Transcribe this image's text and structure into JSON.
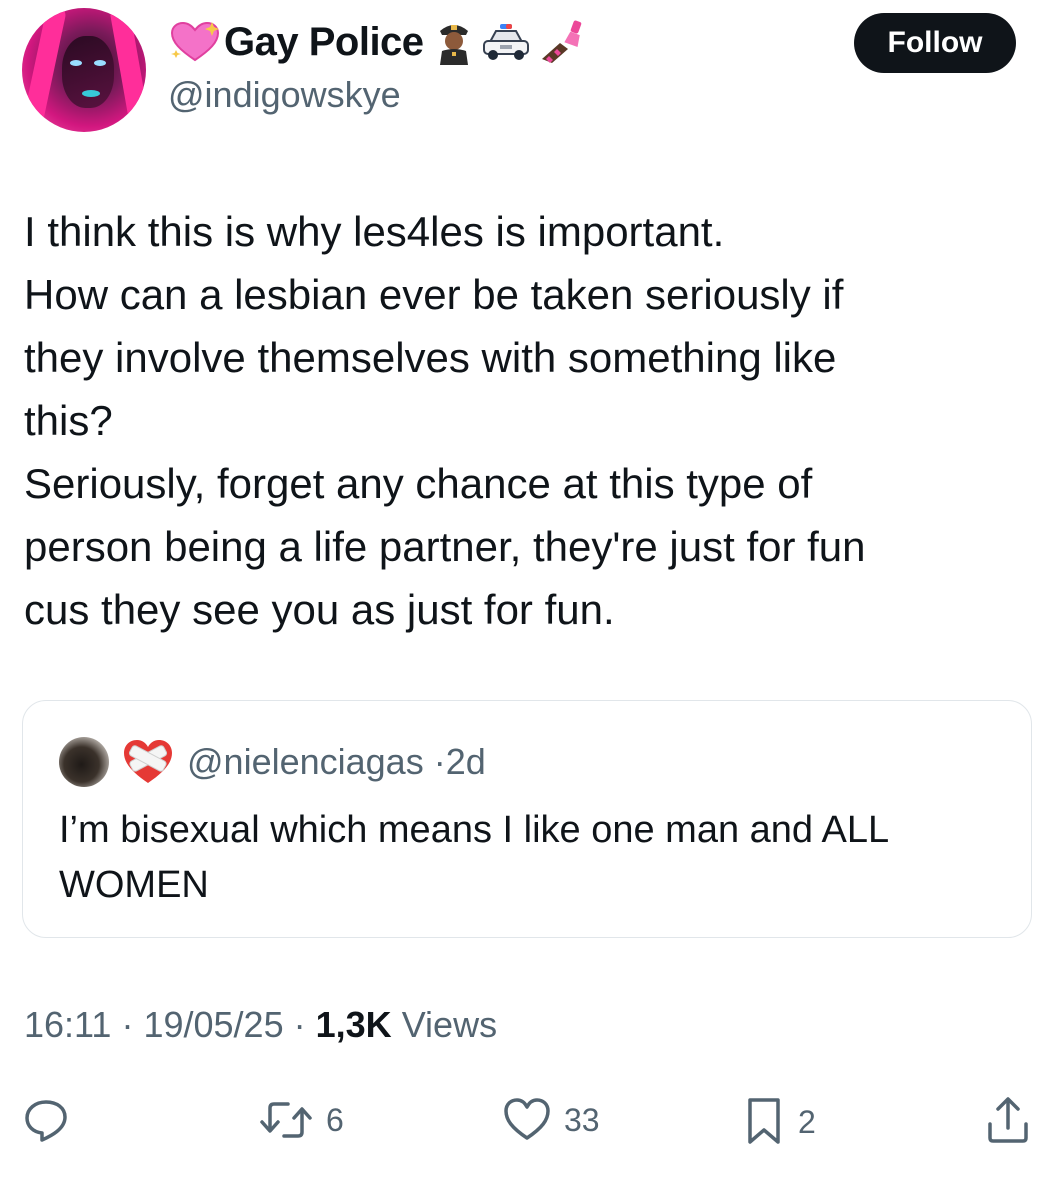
{
  "author": {
    "display_name": "Gay Police",
    "handle": "@indigowskye",
    "name_emojis": [
      "sparkling-heart-icon",
      "police-officer-icon",
      "police-car-icon",
      "nail-polish-icon"
    ]
  },
  "follow_button": {
    "label": "Follow"
  },
  "tweet": {
    "lines": [
      "I think this is why les4les is important.",
      "How can a lesbian ever be taken seriously if",
      "they involve themselves with something like",
      "this?",
      "Seriously, forget any chance at this type of",
      "person being a life partner, they're just for fun",
      "cus they see you as just for fun."
    ]
  },
  "quoted_tweet": {
    "handle": "@nielenciagas",
    "separator": "·",
    "age": "2d",
    "lines": [
      "I’m bisexual which means I like one man and ALL",
      "WOMEN"
    ]
  },
  "meta": {
    "time": "16:11",
    "date": "19/05/25",
    "sep": "·",
    "views_count": "1,3K",
    "views_label": "Views"
  },
  "actions": {
    "reply_count": "",
    "retweet_count": "6",
    "like_count": "33",
    "bookmark_count": "2"
  },
  "colors": {
    "text": "#0f1419",
    "secondary": "#536471",
    "border": "#e1e6ea",
    "follow_bg": "#0f1419"
  }
}
